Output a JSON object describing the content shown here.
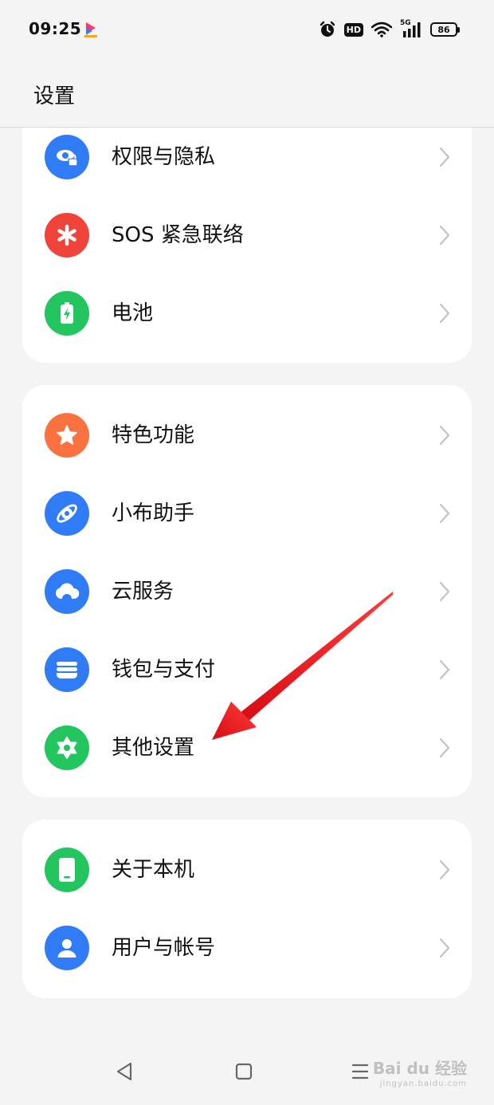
{
  "status_bar": {
    "time": "09:25",
    "hd_label": "HD",
    "network_label": "5G",
    "battery_level": "86"
  },
  "header": {
    "title": "设置"
  },
  "groups": [
    {
      "items": [
        {
          "label": "权限与隐私",
          "icon": "privacy-icon",
          "color": "#2f7cf6"
        },
        {
          "label": "SOS 紧急联络",
          "icon": "sos-icon",
          "color": "#f0433a"
        },
        {
          "label": "电池",
          "icon": "battery-icon",
          "color": "#22c55e"
        }
      ]
    },
    {
      "items": [
        {
          "label": "特色功能",
          "icon": "star-icon",
          "color": "#f97240"
        },
        {
          "label": "小布助手",
          "icon": "assistant-icon",
          "color": "#2f7cf6"
        },
        {
          "label": "云服务",
          "icon": "cloud-icon",
          "color": "#2f7cf6"
        },
        {
          "label": "钱包与支付",
          "icon": "wallet-icon",
          "color": "#2f7cf6"
        },
        {
          "label": "其他设置",
          "icon": "gear-icon",
          "color": "#22c55e"
        }
      ]
    },
    {
      "items": [
        {
          "label": "关于本机",
          "icon": "phone-icon",
          "color": "#22c55e"
        },
        {
          "label": "用户与帐号",
          "icon": "user-icon",
          "color": "#2f7cf6"
        }
      ]
    }
  ],
  "watermark": {
    "brand": "Bai du 经验",
    "url": "jingyan.baidu.com"
  },
  "annotation_color": "#e8141b"
}
